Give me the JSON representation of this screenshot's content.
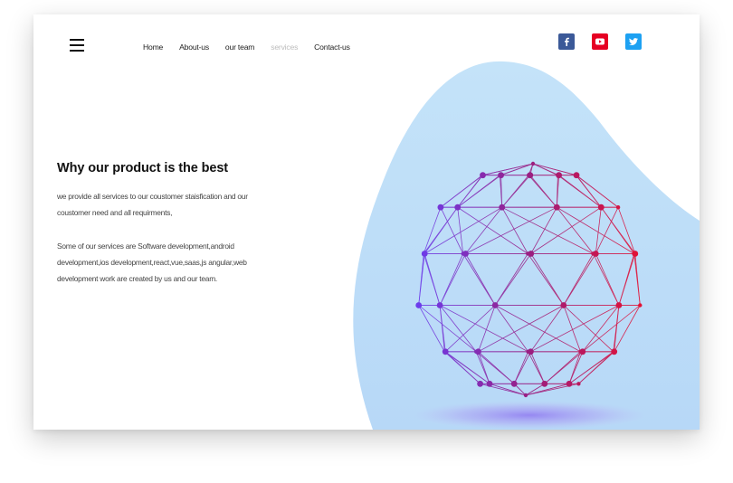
{
  "nav": {
    "items": [
      {
        "label": "Home",
        "active": true
      },
      {
        "label": "About-us",
        "active": true
      },
      {
        "label": "our team",
        "active": true
      },
      {
        "label": "services",
        "active": false
      },
      {
        "label": "Contact-us",
        "active": true
      }
    ]
  },
  "socials": [
    {
      "icon": "facebook-icon",
      "glyph": "f",
      "color": "#3b5998"
    },
    {
      "icon": "youtube-icon",
      "glyph": "▶",
      "color": "#e60023"
    },
    {
      "icon": "twitter-icon",
      "glyph": "t",
      "color": "#1da1f2"
    }
  ],
  "hero": {
    "title": "Why our product is the best",
    "paragraph1": "we provide all services to our coustomer staisfication and our coustomer need and all requirments,",
    "paragraph2": "Some of our services are Software development,android development,ios development,react,vue,saas,js angular,web development work are created by us and our team."
  },
  "colors": {
    "blob": "#bfe0f8",
    "sphere_left": "#6a3df0",
    "sphere_right": "#e8102e"
  }
}
